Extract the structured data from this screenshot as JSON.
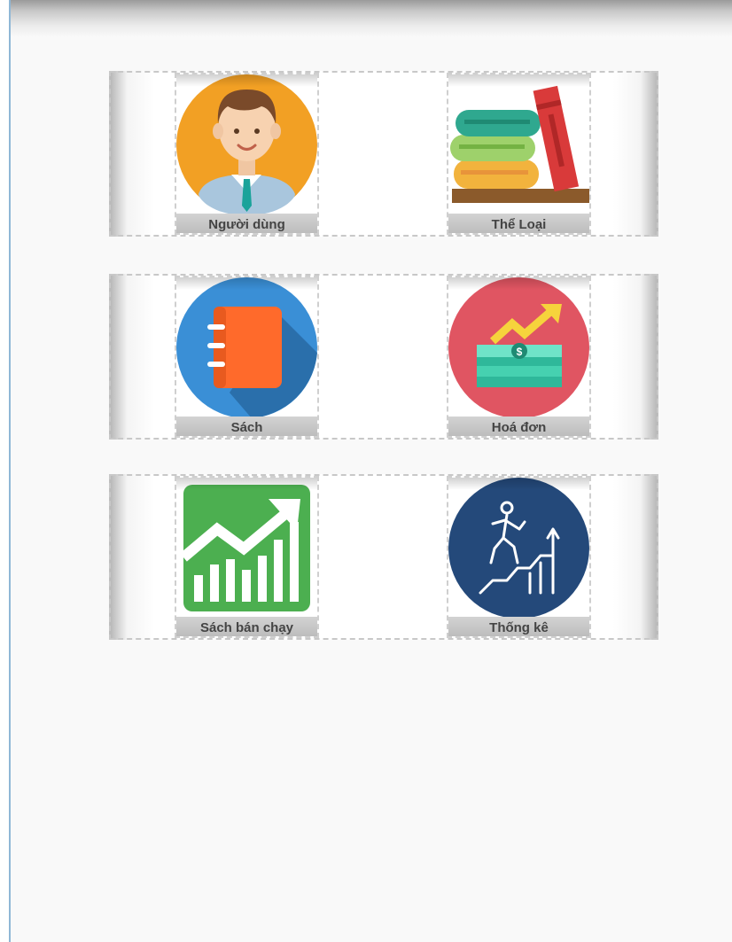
{
  "menu": {
    "tiles": [
      {
        "label": "Người dùng",
        "icon": "user-avatar-icon"
      },
      {
        "label": "Thể Loại",
        "icon": "books-stack-icon"
      },
      {
        "label": "Sách",
        "icon": "notebook-icon"
      },
      {
        "label": "Hoá đơn",
        "icon": "money-growth-icon"
      },
      {
        "label": "Sách bán chạy",
        "icon": "growth-chart-icon"
      },
      {
        "label": "Thống kê",
        "icon": "climbing-stairs-icon"
      }
    ]
  },
  "colors": {
    "background": "#f9f9f9",
    "caption_bar": "#c8c8c8",
    "caption_text": "#444444",
    "user_orange": "#f2a024",
    "notebook_blue": "#3a8fd6",
    "invoice_red": "#e05562",
    "chart_green": "#4caf50",
    "stats_navy": "#24497a"
  }
}
